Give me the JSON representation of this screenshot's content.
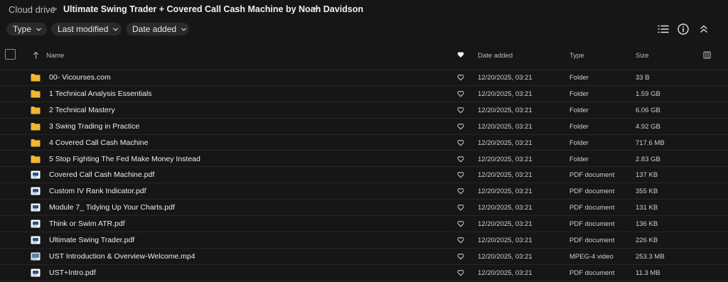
{
  "breadcrumb": {
    "root": "Cloud drive",
    "separator": ">",
    "title": "Ultimate Swing Trader + Covered Call Cash Machine by Noah Davidson"
  },
  "filters": [
    {
      "label": "Type"
    },
    {
      "label": "Last modified"
    },
    {
      "label": "Date added"
    }
  ],
  "toolbar": {
    "list_view_icon": "list-icon",
    "info_icon": "info-icon",
    "collapse_icon": "collapse-icon"
  },
  "columns": {
    "name": "Name",
    "date_added": "Date added",
    "type": "Type",
    "size": "Size"
  },
  "colors": {
    "folder": "#f2b632",
    "background": "#161616",
    "chip": "#2a2a2a"
  },
  "rows": [
    {
      "name": "00- Vicourses.com",
      "date": "12/20/2025, 03:21",
      "type": "Folder",
      "size": "33 B",
      "icon": "folder-icon"
    },
    {
      "name": "1 Technical Analysis Essentials",
      "date": "12/20/2025, 03:21",
      "type": "Folder",
      "size": "1.59 GB",
      "icon": "folder-icon"
    },
    {
      "name": "2 Technical Mastery",
      "date": "12/20/2025, 03:21",
      "type": "Folder",
      "size": "6.06 GB",
      "icon": "folder-icon"
    },
    {
      "name": "3 Swing Trading in Practice",
      "date": "12/20/2025, 03:21",
      "type": "Folder",
      "size": "4.92 GB",
      "icon": "folder-icon"
    },
    {
      "name": "4 Covered Call Cash Machine",
      "date": "12/20/2025, 03:21",
      "type": "Folder",
      "size": "717.6 MB",
      "icon": "folder-icon"
    },
    {
      "name": "5 Stop Fighting The Fed Make Money Instead",
      "date": "12/20/2025, 03:21",
      "type": "Folder",
      "size": "2.83 GB",
      "icon": "folder-icon"
    },
    {
      "name": "Covered Call Cash Machine.pdf",
      "date": "12/20/2025, 03:21",
      "type": "PDF document",
      "size": "137 KB",
      "icon": "pdf-thumbnail-icon"
    },
    {
      "name": "Custom IV Rank Indicator.pdf",
      "date": "12/20/2025, 03:21",
      "type": "PDF document",
      "size": "355 KB",
      "icon": "pdf-thumbnail-icon"
    },
    {
      "name": "Module 7_ Tidying Up Your Charts.pdf",
      "date": "12/20/2025, 03:21",
      "type": "PDF document",
      "size": "131 KB",
      "icon": "pdf-thumbnail-icon"
    },
    {
      "name": "Think or Swim ATR.pdf",
      "date": "12/20/2025, 03:21",
      "type": "PDF document",
      "size": "136 KB",
      "icon": "pdf-thumbnail-icon"
    },
    {
      "name": "Ultimate Swing Trader.pdf",
      "date": "12/20/2025, 03:21",
      "type": "PDF document",
      "size": "226 KB",
      "icon": "pdf-thumbnail-icon"
    },
    {
      "name": "UST Introduction & Overview-Welcome.mp4",
      "date": "12/20/2025, 03:21",
      "type": "MPEG-4 video",
      "size": "253.3 MB",
      "icon": "video-thumbnail-icon"
    },
    {
      "name": "UST+Intro.pdf",
      "date": "12/20/2025, 03:21",
      "type": "PDF document",
      "size": "11.3 MB",
      "icon": "pdf-thumbnail-icon"
    }
  ]
}
